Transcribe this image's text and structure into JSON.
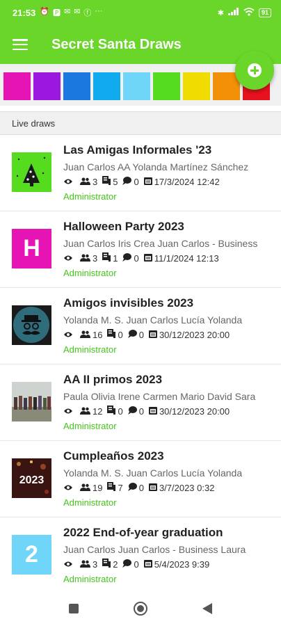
{
  "status_bar": {
    "time": "21:53",
    "battery": "91",
    "notifications": [
      "alarm-icon",
      "p-icon",
      "mail-icon",
      "mail-icon",
      "facebook-icon",
      "more-icon"
    ]
  },
  "app_bar": {
    "title": "Secret Santa Draws"
  },
  "colors": [
    "#e614b4",
    "#9a18e0",
    "#1b78e0",
    "#10aaee",
    "#6fd6fa",
    "#56dc1e",
    "#f0dc00",
    "#f29108",
    "#e8121e"
  ],
  "section": {
    "title": "Live draws"
  },
  "draws": [
    {
      "title": "Las Amigas Informales '23",
      "participants": "Juan Carlos AA Yolanda Martínez Sánchez",
      "views": "",
      "people": "3",
      "gifts": "5",
      "messages": "0",
      "date": "17/3/2024 12:42",
      "role": "Administrator",
      "thumb_type": "tree",
      "thumb_color": "#56dc1e"
    },
    {
      "title": "Halloween Party 2023",
      "participants": "Juan Carlos Iris Crea Juan Carlos - Business",
      "views": "",
      "people": "3",
      "gifts": "1",
      "messages": "0",
      "date": "11/1/2024 12:13",
      "role": "Administrator",
      "thumb_type": "letter",
      "thumb_letter": "H",
      "thumb_color": "#e614b4"
    },
    {
      "title": "Amigos invisibles 2023",
      "participants": "Yolanda M. S. Juan Carlos Lucía Yolanda",
      "views": "",
      "people": "16",
      "gifts": "0",
      "messages": "0",
      "date": "30/12/2023 20:00",
      "role": "Administrator",
      "thumb_type": "mustache",
      "thumb_color": "#1a1a1a"
    },
    {
      "title": "AA II primos 2023",
      "participants": "Paula Olivia Irene Carmen Mario David Sara",
      "views": "",
      "people": "12",
      "gifts": "0",
      "messages": "0",
      "date": "30/12/2023 20:00",
      "role": "Administrator",
      "thumb_type": "photo",
      "thumb_color": "#a8a898"
    },
    {
      "title": "Cumpleaños 2023",
      "participants": "Yolanda M. S. Juan Carlos Lucía Yolanda",
      "views": "",
      "people": "19",
      "gifts": "7",
      "messages": "0",
      "date": "3/7/2023 0:32",
      "role": "Administrator",
      "thumb_type": "photo2023",
      "thumb_text": "2023",
      "thumb_color": "#3a1410"
    },
    {
      "title": "2022 End-of-year graduation",
      "participants": "Juan Carlos Juan Carlos - Business Laura",
      "views": "",
      "people": "3",
      "gifts": "2",
      "messages": "0",
      "date": "5/4/2023 9:39",
      "role": "Administrator",
      "thumb_type": "letter",
      "thumb_letter": "2",
      "thumb_color": "#6fd6fa"
    }
  ]
}
